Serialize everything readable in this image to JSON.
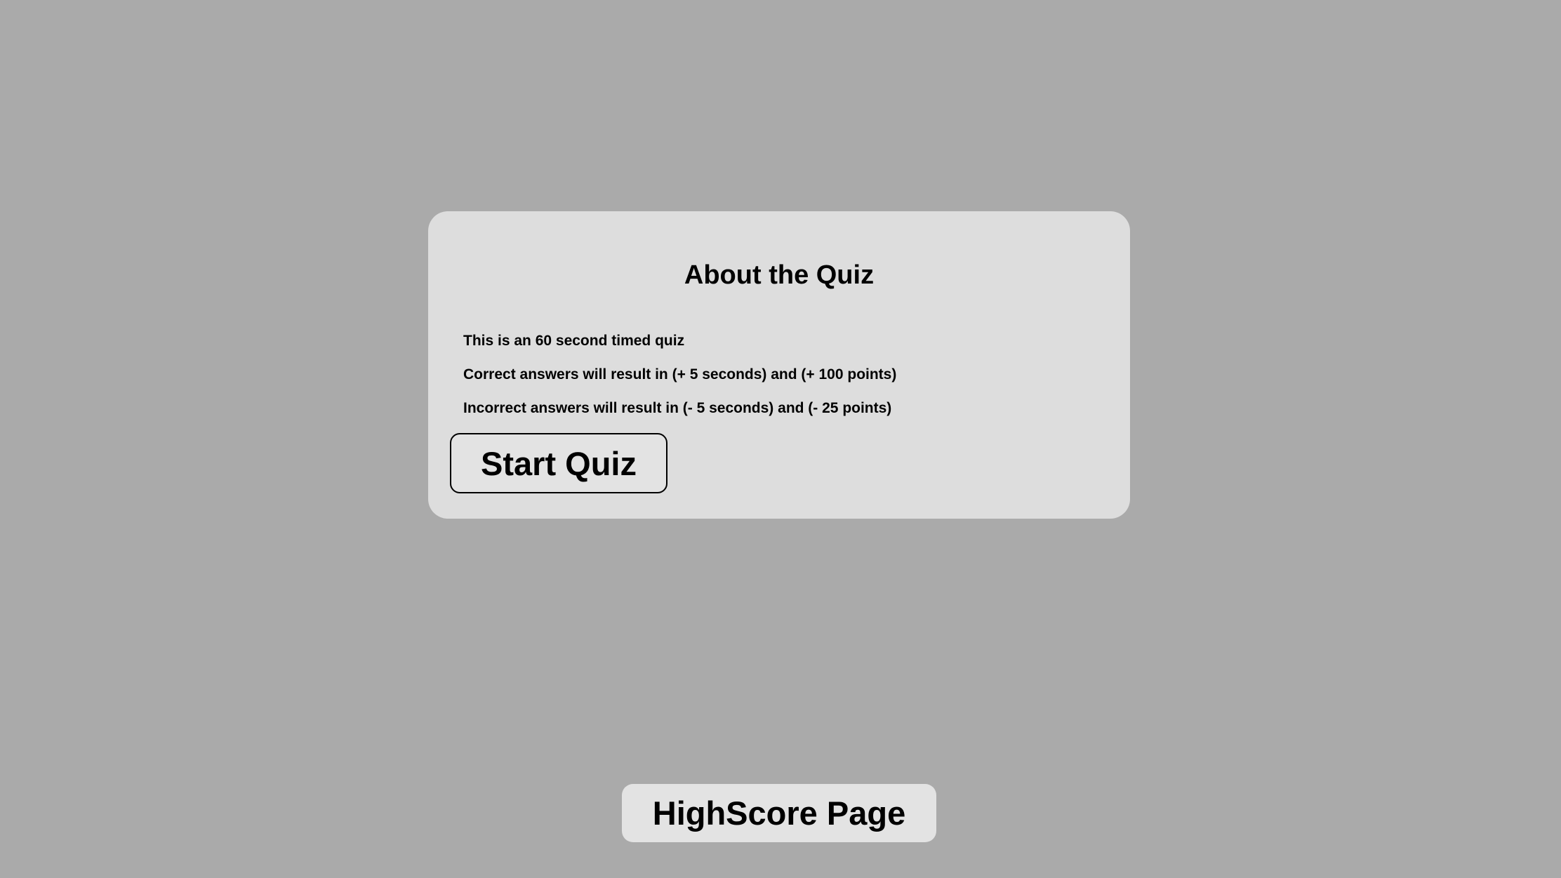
{
  "about": {
    "title": "About the Quiz",
    "rules": [
      "This is an 60 second timed quiz",
      "Correct answers will result in (+ 5 seconds) and (+ 100 points)",
      "Incorrect answers will result in (- 5 seconds) and (- 25 points)"
    ],
    "start_label": "Start Quiz"
  },
  "footer": {
    "highscore_label": "HighScore Page"
  },
  "colors": {
    "page_background": "#aaaaaa",
    "card_background": "#dddddd",
    "button_background": "#e3e3e3",
    "text": "#000000"
  }
}
